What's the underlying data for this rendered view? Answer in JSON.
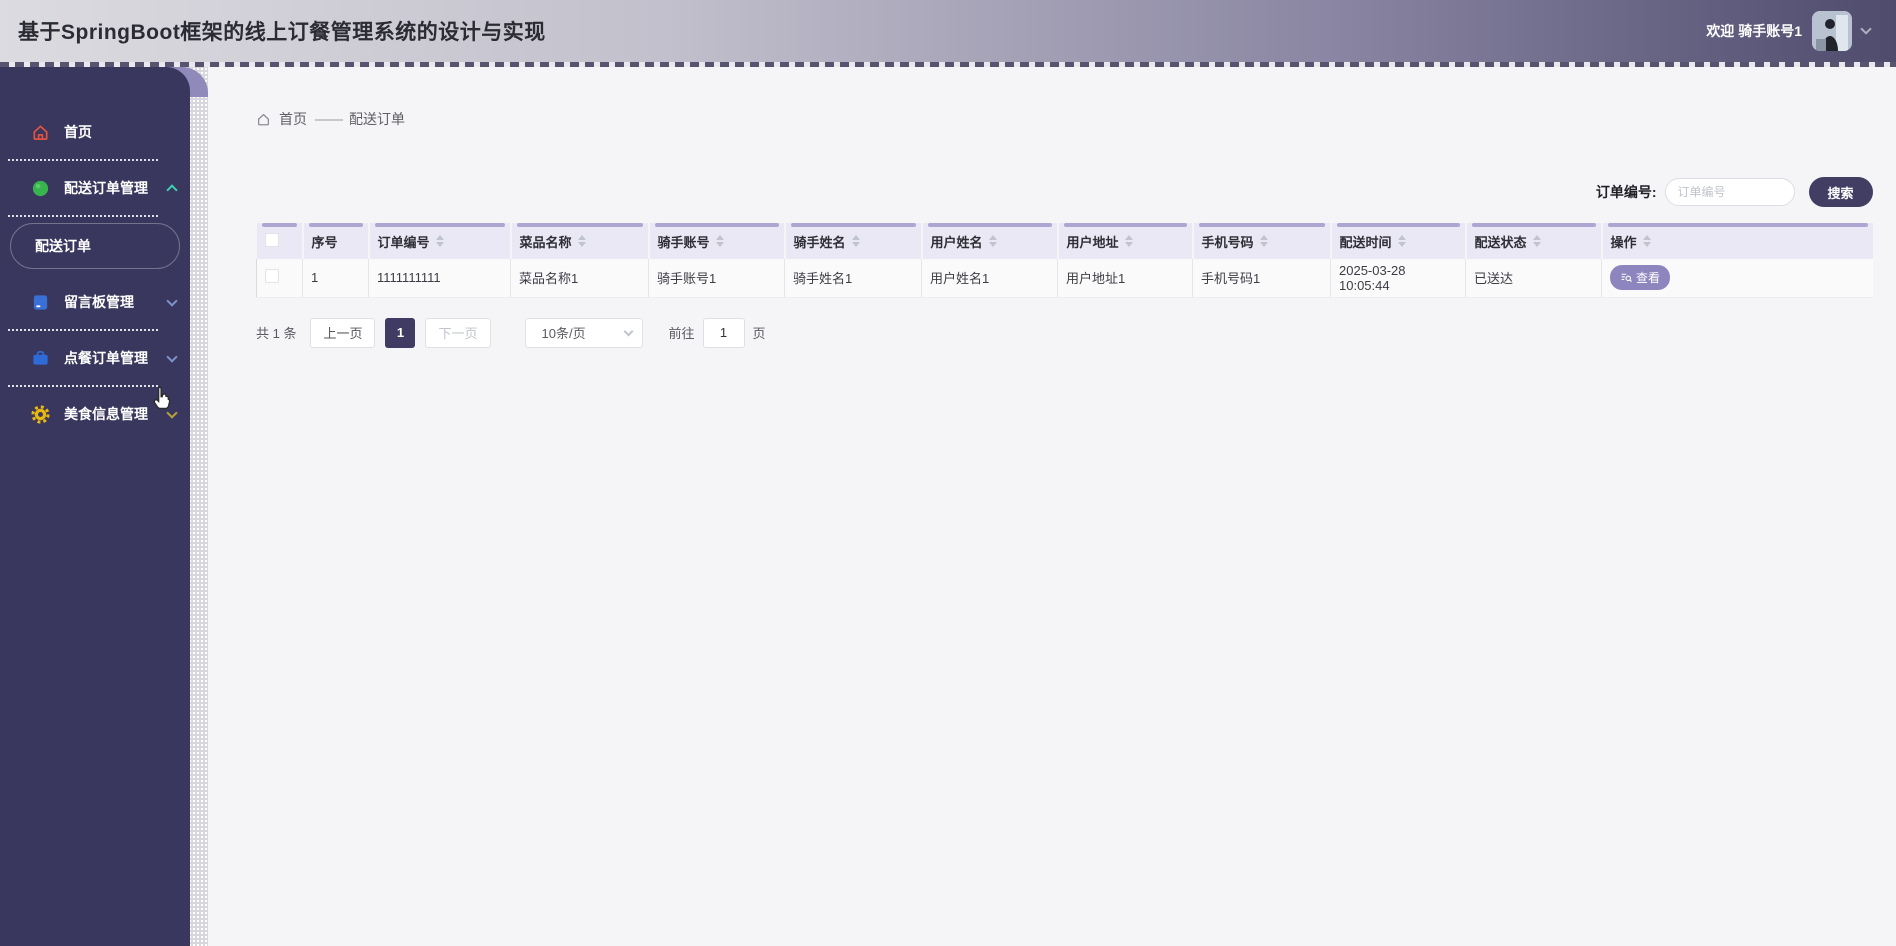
{
  "header": {
    "title": "基于SpringBoot框架的线上订餐管理系统的设计与实现",
    "welcome": "欢迎 骑手账号1"
  },
  "sidebar": {
    "items": [
      {
        "label": "首页",
        "icon": "home-icon"
      },
      {
        "label": "配送订单管理",
        "icon": "green-dot-icon",
        "expanded": true
      },
      {
        "label": "留言板管理",
        "icon": "message-board-icon"
      },
      {
        "label": "点餐订单管理",
        "icon": "briefcase-icon"
      },
      {
        "label": "美食信息管理",
        "icon": "gear-icon"
      }
    ],
    "submenu": {
      "label": "配送订单",
      "active": true
    }
  },
  "breadcrumb": {
    "home": "首页",
    "separator": "——",
    "current": "配送订单"
  },
  "search": {
    "label": "订单编号:",
    "placeholder": "订单编号",
    "button": "搜索"
  },
  "table": {
    "columns": [
      "序号",
      "订单编号",
      "菜品名称",
      "骑手账号",
      "骑手姓名",
      "用户姓名",
      "用户地址",
      "手机号码",
      "配送时间",
      "配送状态",
      "操作"
    ],
    "rows": [
      {
        "cells": [
          "1",
          "1111111111",
          "菜品名称1",
          "骑手账号1",
          "骑手姓名1",
          "用户姓名1",
          "用户地址1",
          "手机号码1",
          "2025-03-28 10:05:44",
          "已送达"
        ],
        "action": "查看"
      }
    ]
  },
  "pagination": {
    "total": "共 1 条",
    "prev": "上一页",
    "page": "1",
    "next": "下一页",
    "page_size": "10条/页",
    "goto_label": "前往",
    "goto_value": "1",
    "unit": "页"
  },
  "colors": {
    "sidebar": "#39375d",
    "header_dark": "#4f4b6d",
    "accent_button": "#413d63",
    "action_button": "#8d85bd",
    "table_header_bg": "#eae8f4"
  }
}
